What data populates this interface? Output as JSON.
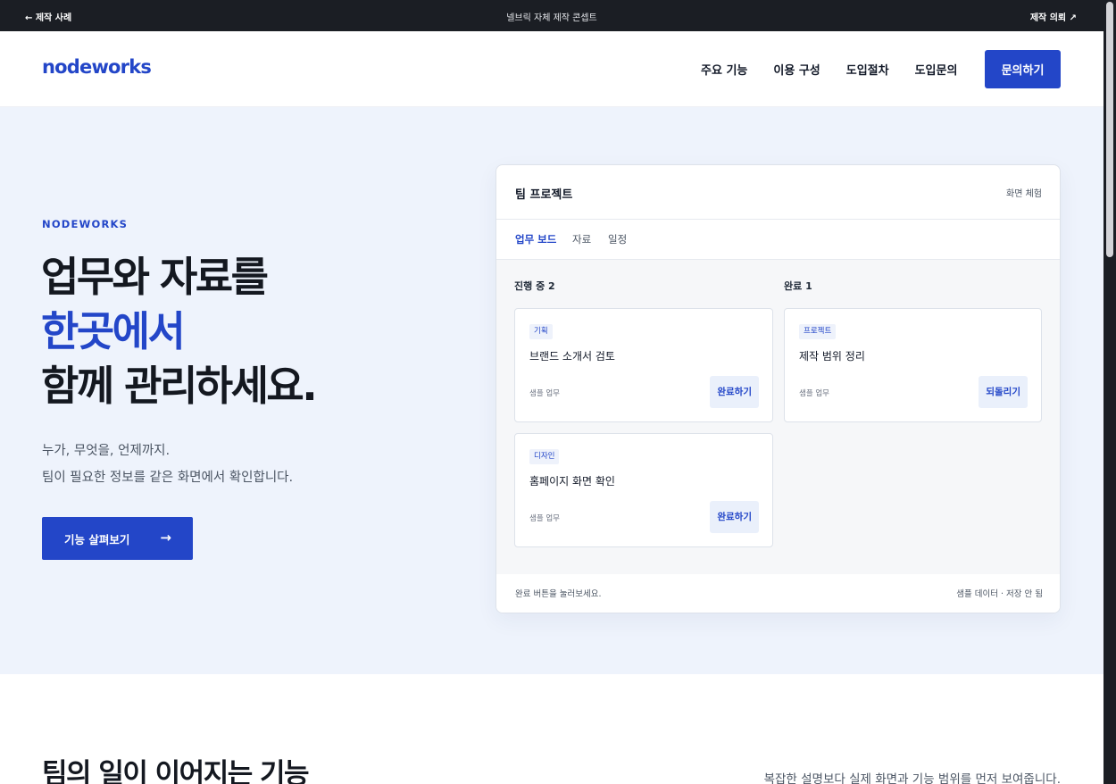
{
  "topbar": {
    "back_label": "← 제작 사례",
    "center_label": "넬브릭 자체 제작 콘셉트",
    "request_label": "제작 의뢰 ↗"
  },
  "header": {
    "logo": "nodeworks",
    "nav": [
      "주요 기능",
      "이용 구성",
      "도입절차",
      "도입문의"
    ],
    "cta_label": "문의하기"
  },
  "hero": {
    "eyebrow": "NODEWORKS",
    "headline_line1": "업무와 자료를",
    "headline_line2": "한곳에서",
    "headline_line3": "함께 관리하세요.",
    "sub_line1": "누가, 무엇을, 언제까지.",
    "sub_line2": "팀이 필요한 정보를 같은 화면에서 확인합니다.",
    "cta_label": "기능 살펴보기",
    "cta_arrow": "→"
  },
  "app": {
    "title": "팀 프로젝트",
    "demo_label": "화면 체험",
    "tabs": [
      "업무 보드",
      "자료",
      "일정"
    ],
    "columns": [
      {
        "title": "진행 중 2"
      },
      {
        "title": "완료 1"
      }
    ],
    "tasks": [
      {
        "tag": "기획",
        "name": "브랜드 소개서 검토",
        "meta": "샘플 업무",
        "action": "완료하기"
      },
      {
        "tag": "디자인",
        "name": "홈페이지 화면 확인",
        "meta": "샘플 업무",
        "action": "완료하기"
      },
      {
        "tag": "프로젝트",
        "name": "제작 범위 정리",
        "meta": "샘플 업무",
        "action": "되돌리기"
      }
    ],
    "footer_left": "완료 버튼을 눌러보세요.",
    "footer_right": "샘플 데이터 · 저장 안 됨"
  },
  "features": {
    "title": "팀의 일이 이어지는 기능",
    "description": "복잡한 설명보다 실제 화면과 기능 범위를 먼저 보여줍니다."
  },
  "colors": {
    "brand": "#2346c8",
    "topbar_bg": "#1b1e24",
    "hero_bg": "#eef3fc"
  }
}
